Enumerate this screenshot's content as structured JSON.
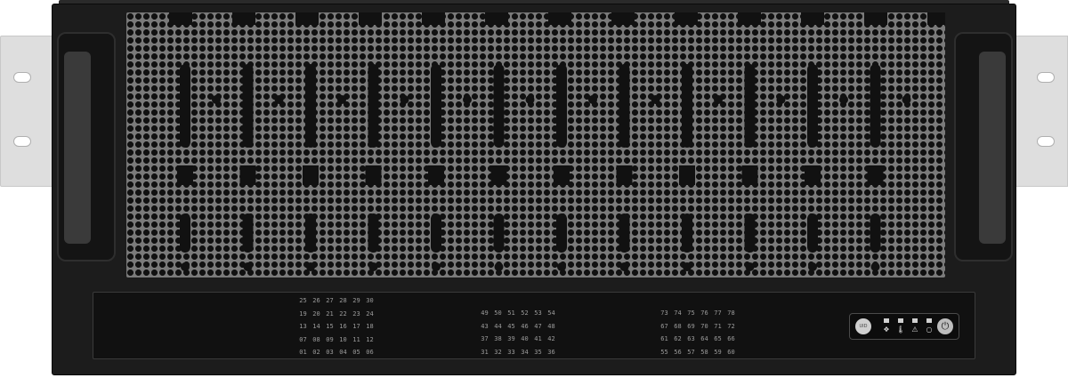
{
  "bay_groups": [
    [
      [
        "25",
        "26",
        "27",
        "28",
        "29",
        "30"
      ],
      [
        "19",
        "20",
        "21",
        "22",
        "23",
        "24"
      ],
      [
        "13",
        "14",
        "15",
        "16",
        "17",
        "18"
      ],
      [
        "07",
        "08",
        "09",
        "10",
        "11",
        "12"
      ],
      [
        "01",
        "02",
        "03",
        "04",
        "05",
        "06"
      ]
    ],
    [
      [
        "49",
        "50",
        "51",
        "52",
        "53",
        "54"
      ],
      [
        "43",
        "44",
        "45",
        "46",
        "47",
        "48"
      ],
      [
        "37",
        "38",
        "39",
        "40",
        "41",
        "42"
      ],
      [
        "31",
        "32",
        "33",
        "34",
        "35",
        "36"
      ]
    ],
    [
      [
        "73",
        "74",
        "75",
        "76",
        "77",
        "78"
      ],
      [
        "67",
        "68",
        "69",
        "70",
        "71",
        "72"
      ],
      [
        "61",
        "62",
        "63",
        "64",
        "65",
        "66"
      ],
      [
        "55",
        "56",
        "57",
        "58",
        "59",
        "60"
      ]
    ]
  ],
  "controls": {
    "id_label": "UID",
    "indicators": [
      {
        "name": "fan",
        "glyph": "❖"
      },
      {
        "name": "temperature",
        "glyph": "🌡"
      },
      {
        "name": "warning",
        "glyph": "⚠"
      },
      {
        "name": "status",
        "glyph": "○"
      }
    ],
    "power_glyph": "⏻"
  },
  "colors": {
    "chassis": "#1c1c1c",
    "mesh": "#7a7a7a",
    "bay_label": "#9b9b9b",
    "led": "#d0d0d0"
  }
}
